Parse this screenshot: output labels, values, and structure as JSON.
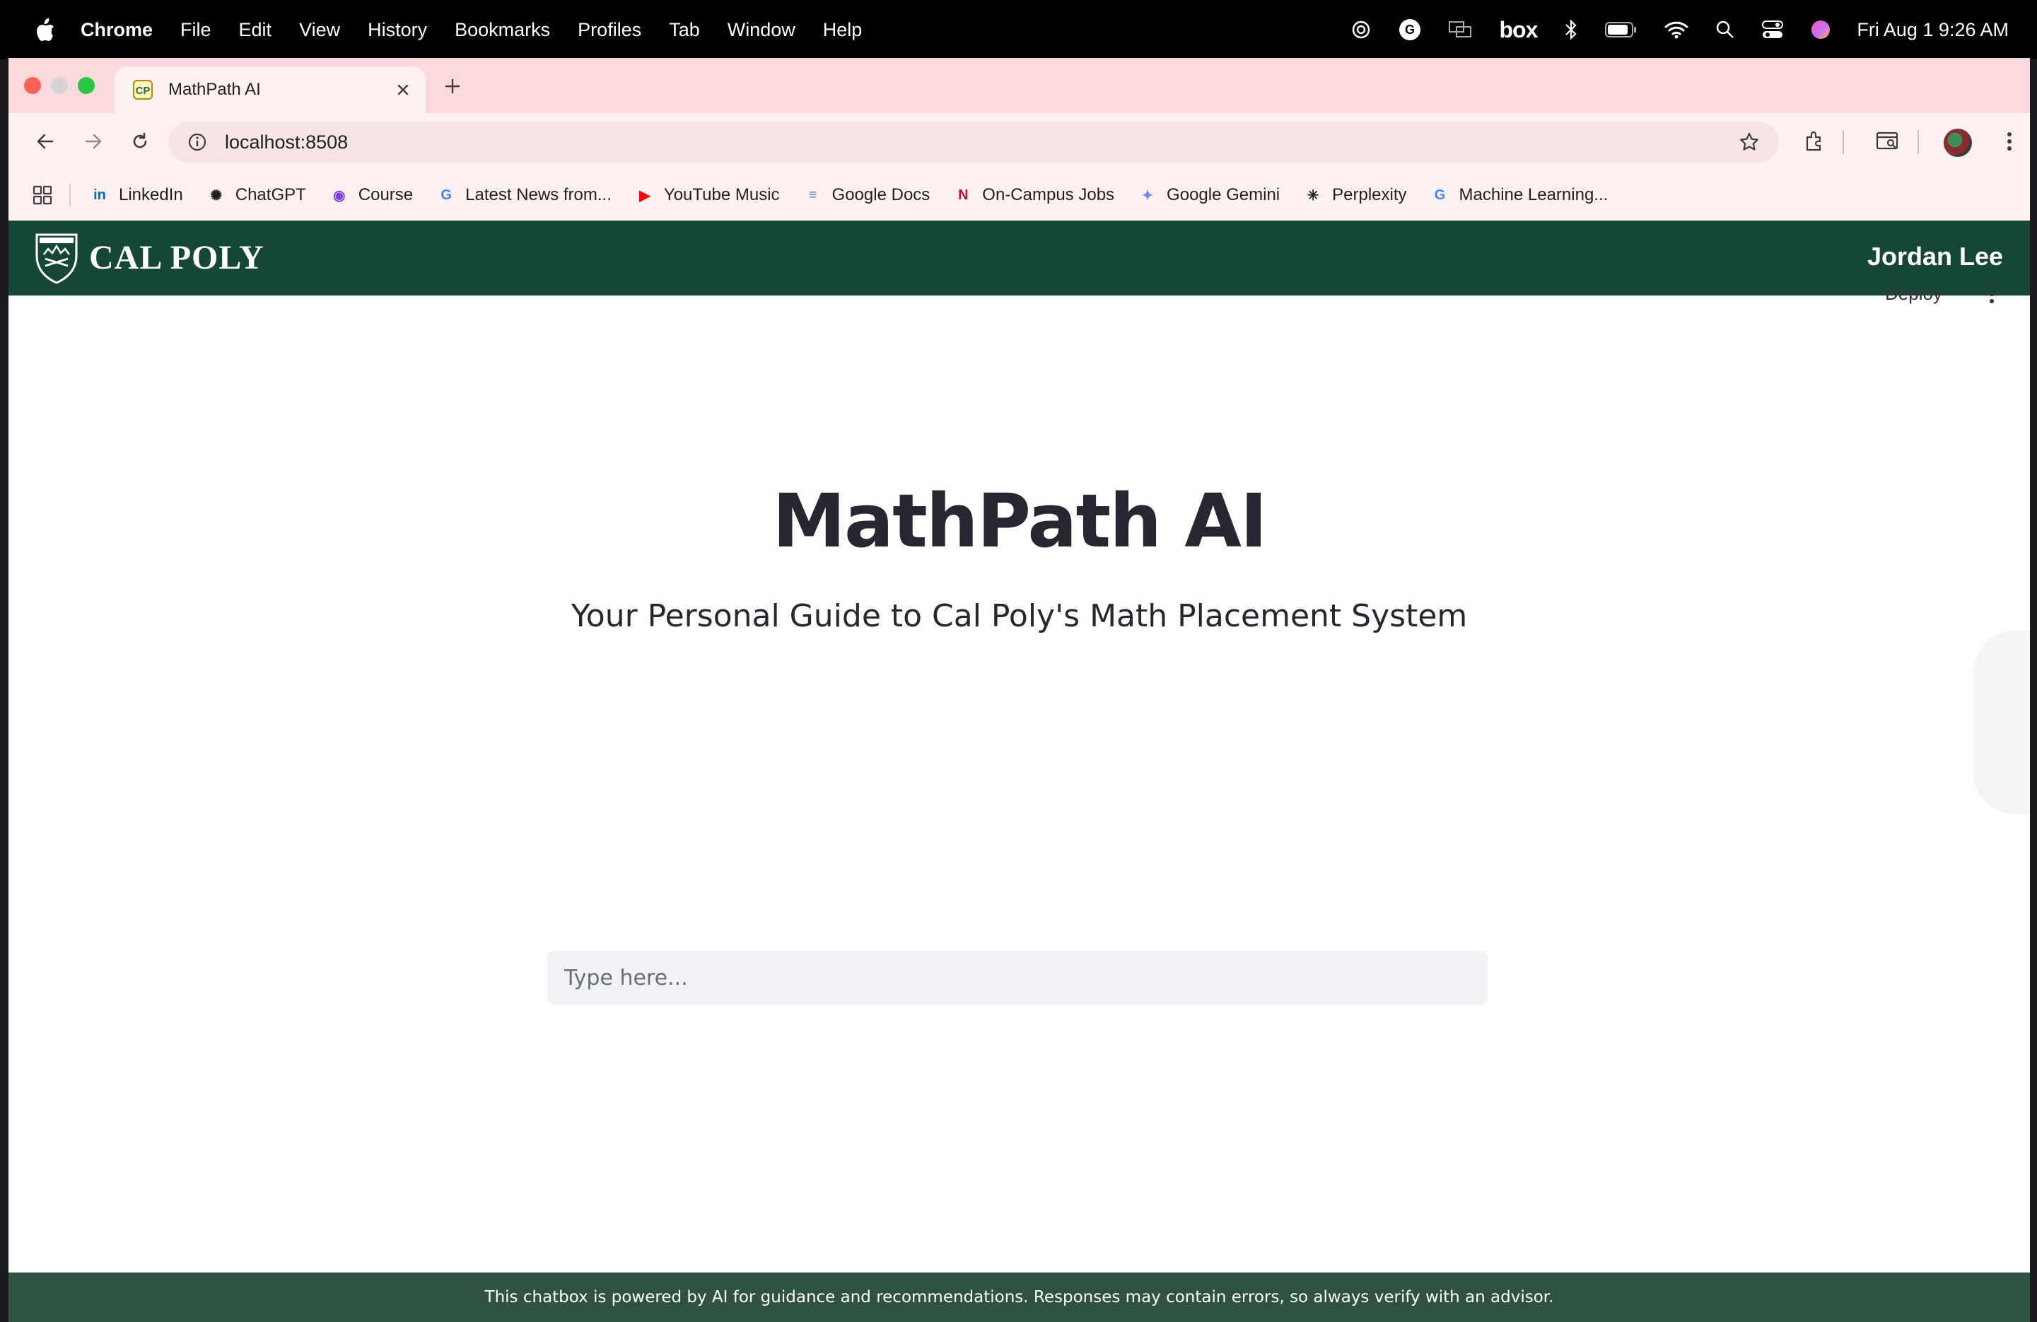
{
  "menubar": {
    "items": [
      "Chrome",
      "File",
      "Edit",
      "View",
      "History",
      "Bookmarks",
      "Profiles",
      "Tab",
      "Window",
      "Help"
    ],
    "box_label": "box",
    "clock": "Fri Aug 1  9:26 AM"
  },
  "browser": {
    "tab_title": "MathPath AI",
    "url": "localhost:8508",
    "bookmarks": [
      {
        "label": "LinkedIn",
        "icon": "linkedin-icon",
        "color": "#0a66c2",
        "glyph": "in"
      },
      {
        "label": "ChatGPT",
        "icon": "chatgpt-icon",
        "color": "#1f1f1f",
        "glyph": "✺"
      },
      {
        "label": "Course",
        "icon": "course-icon",
        "color": "#7b3fe4",
        "glyph": "◉"
      },
      {
        "label": "Latest News from...",
        "icon": "google-icon",
        "color": "#4285f4",
        "glyph": "G"
      },
      {
        "label": "YouTube Music",
        "icon": "youtube-music-icon",
        "color": "#ff0000",
        "glyph": "▶"
      },
      {
        "label": "Google Docs",
        "icon": "google-docs-icon",
        "color": "#4285f4",
        "glyph": "≡"
      },
      {
        "label": "On-Campus Jobs",
        "icon": "handshake-icon",
        "color": "#c8102e",
        "glyph": "N"
      },
      {
        "label": "Google Gemini",
        "icon": "gemini-icon",
        "color": "#6c8cff",
        "glyph": "✦"
      },
      {
        "label": "Perplexity",
        "icon": "perplexity-icon",
        "color": "#1f1f1f",
        "glyph": "✳"
      },
      {
        "label": "Machine Learning...",
        "icon": "google-icon",
        "color": "#4285f4",
        "glyph": "G"
      }
    ]
  },
  "header": {
    "logo_text": "CAL POLY",
    "user_name": "Jordan Lee"
  },
  "toolbar": {
    "deploy_label": "Deploy"
  },
  "main": {
    "title": "MathPath AI",
    "subtitle": "Your Personal Guide to Cal Poly's Math Placement System",
    "input_placeholder": "Type here...",
    "input_value": ""
  },
  "footer": {
    "text": "This chatbox is powered by AI for guidance and recommendations. Responses may contain errors, so always verify with an advisor."
  },
  "colors": {
    "header_green": "#154734",
    "footer_green": "#2f5243",
    "tabstrip_pink": "#fadadd"
  }
}
